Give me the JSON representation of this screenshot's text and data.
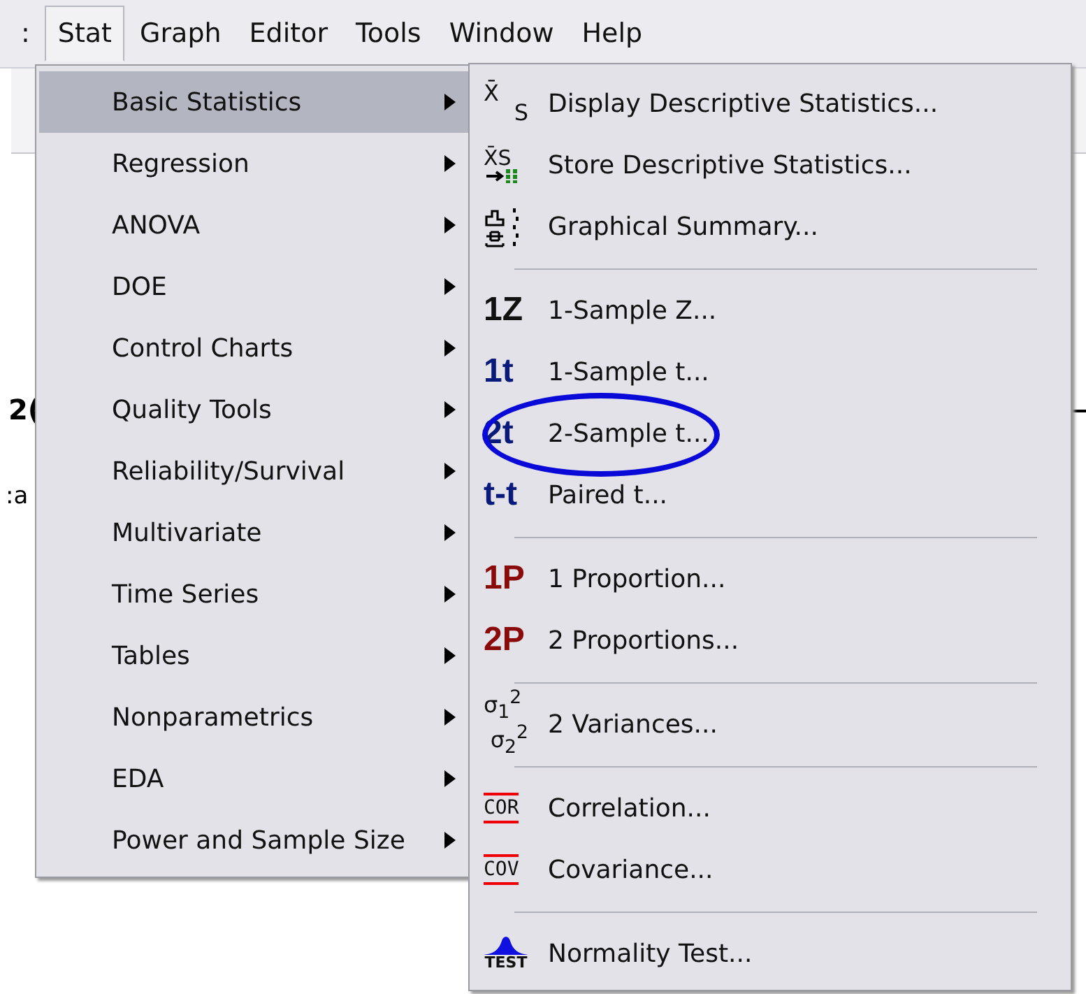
{
  "menubar": [
    {
      "label": ":",
      "selected": false
    },
    {
      "label": "Stat",
      "selected": true
    },
    {
      "label": "Graph",
      "selected": false
    },
    {
      "label": "Editor",
      "selected": false
    },
    {
      "label": "Tools",
      "selected": false
    },
    {
      "label": "Window",
      "selected": false
    },
    {
      "label": "Help",
      "selected": false
    }
  ],
  "background_text": [
    "2(",
    ":a"
  ],
  "stat_menu": [
    {
      "label": "Basic Statistics",
      "selected": true
    },
    {
      "label": "Regression",
      "selected": false
    },
    {
      "label": "ANOVA",
      "selected": false
    },
    {
      "label": "DOE",
      "selected": false
    },
    {
      "label": "Control Charts",
      "selected": false
    },
    {
      "label": "Quality Tools",
      "selected": false
    },
    {
      "label": "Reliability/Survival",
      "selected": false
    },
    {
      "label": "Multivariate",
      "selected": false
    },
    {
      "label": "Time Series",
      "selected": false
    },
    {
      "label": "Tables",
      "selected": false
    },
    {
      "label": "Nonparametrics",
      "selected": false
    },
    {
      "label": "EDA",
      "selected": false
    },
    {
      "label": "Power and Sample Size",
      "selected": false
    }
  ],
  "basic_statistics_menu": [
    {
      "kind": "item",
      "label": "Display Descriptive Statistics...",
      "circled": false,
      "icon": {
        "kind": "pair",
        "top": "X̄",
        "bottom": "S"
      }
    },
    {
      "kind": "item",
      "label": "Store Descriptive Statistics...",
      "circled": false,
      "icon": {
        "kind": "store",
        "top": "X̄S"
      }
    },
    {
      "kind": "item",
      "label": "Graphical Summary...",
      "circled": false,
      "icon": {
        "kind": "summary"
      }
    },
    {
      "kind": "separator"
    },
    {
      "kind": "item",
      "label": "1-Sample Z...",
      "circled": false,
      "icon": {
        "kind": "text",
        "text": "1Z",
        "color": "#111111"
      }
    },
    {
      "kind": "item",
      "label": "1-Sample t...",
      "circled": false,
      "icon": {
        "kind": "text",
        "text": "1t",
        "color": "#0a1a7a"
      }
    },
    {
      "kind": "item",
      "label": "2-Sample t...",
      "circled": true,
      "icon": {
        "kind": "text",
        "text": "2t",
        "color": "#0a1a7a"
      }
    },
    {
      "kind": "item",
      "label": "Paired t...",
      "circled": false,
      "icon": {
        "kind": "text",
        "text": "t-t",
        "color": "#0a1a7a"
      }
    },
    {
      "kind": "separator"
    },
    {
      "kind": "item",
      "label": "1 Proportion...",
      "circled": false,
      "icon": {
        "kind": "text",
        "text": "1P",
        "color": "#8a0a0a"
      }
    },
    {
      "kind": "item",
      "label": "2 Proportions...",
      "circled": false,
      "icon": {
        "kind": "text",
        "text": "2P",
        "color": "#8a0a0a"
      }
    },
    {
      "kind": "separator"
    },
    {
      "kind": "item",
      "label": "2 Variances...",
      "circled": false,
      "icon": {
        "kind": "pair",
        "top": "σ$_{1}$$^{2}$",
        "bottom": "σ$_{2}$$^{2}$"
      }
    },
    {
      "kind": "separator"
    },
    {
      "kind": "item",
      "label": "Correlation...",
      "circled": false,
      "icon": {
        "kind": "bracket",
        "text": "COR"
      }
    },
    {
      "kind": "item",
      "label": "Covariance...",
      "circled": false,
      "icon": {
        "kind": "bracket",
        "text": "COV"
      }
    },
    {
      "kind": "separator"
    },
    {
      "kind": "item",
      "label": "Normality Test...",
      "circled": false,
      "icon": {
        "kind": "bell",
        "text": "TEST"
      }
    }
  ]
}
